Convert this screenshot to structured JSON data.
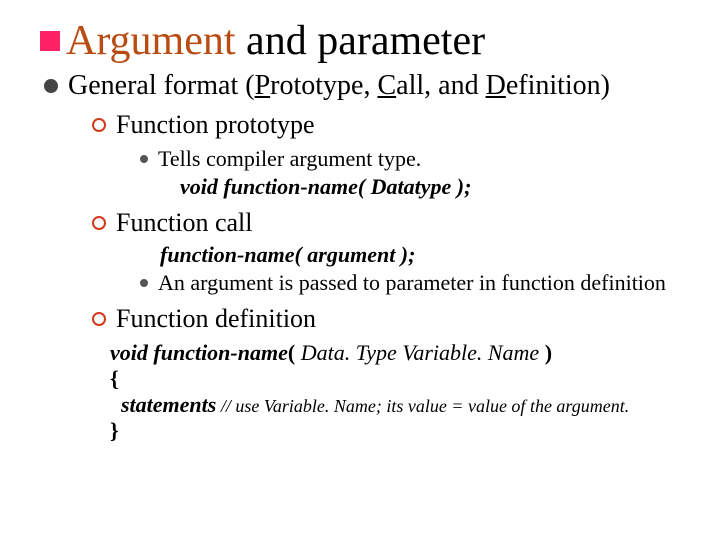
{
  "title": {
    "accent": "Argument",
    "rest": " and parameter"
  },
  "lvl1": {
    "prefix": "General format (",
    "p": "P",
    "p_rest": "rototype, ",
    "c": "C",
    "c_rest": "all, and ",
    "d": "D",
    "d_rest": "efinition)"
  },
  "sec1": {
    "heading": "Function prototype",
    "bullet1": "Tells compiler argument type.",
    "code": "void function-name( Datatype );"
  },
  "sec2": {
    "heading": "Function call",
    "code": "function-name( argument );",
    "bullet1": "An argument is passed to parameter in function definition"
  },
  "sec3": {
    "heading": "Function definition",
    "line1_a": "void  ",
    "line1_b": "function-name",
    "line1_c": "( ",
    "line1_d": "Data. Type Variable. Name",
    "line1_e": " )",
    "brace_open": "{",
    "stmts_label": "statements",
    "stmts_comment": "  // use Variable. Name; its value = value of the argument.",
    "brace_close": "}"
  }
}
